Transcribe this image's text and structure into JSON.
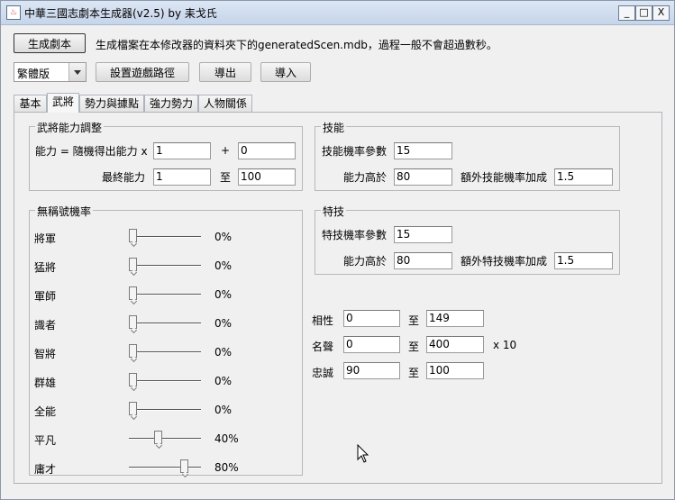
{
  "window": {
    "title": "中華三國志劇本生成器(v2.5) by 耒戈氏",
    "icon_label": "♨",
    "controls": [
      "_",
      "□",
      "X"
    ]
  },
  "top": {
    "generate_button": "生成劇本",
    "generate_hint": "生成檔案在本修改器的資料夾下的generatedScen.mdb，過程一般不會超過數秒。",
    "language_select": "繁體版",
    "set_path_button": "設置遊戲路徑",
    "export_button": "導出",
    "import_button": "導入"
  },
  "tabs": [
    "基本",
    "武將",
    "勢力與據點",
    "強力勢力",
    "人物關係"
  ],
  "active_tab": "武將",
  "ability": {
    "group_title": "武將能力調整",
    "formula_label": "能力 = 隨機得出能力 x",
    "multiplier": "1",
    "plus_label": "+",
    "offset": "0",
    "final_label": "最終能力",
    "final_min": "1",
    "to_label": "至",
    "final_max": "100"
  },
  "rank": {
    "group_title": "無稱號機率",
    "rows": [
      {
        "label": "將軍",
        "value": "0%",
        "level": 0
      },
      {
        "label": "猛將",
        "value": "0%",
        "level": 0
      },
      {
        "label": "軍師",
        "value": "0%",
        "level": 0
      },
      {
        "label": "識者",
        "value": "0%",
        "level": 0
      },
      {
        "label": "智將",
        "value": "0%",
        "level": 0
      },
      {
        "label": "群雄",
        "value": "0%",
        "level": 0
      },
      {
        "label": "全能",
        "value": "0%",
        "level": 0
      },
      {
        "label": "平凡",
        "value": "40%",
        "level": 0.4
      },
      {
        "label": "庸才",
        "value": "80%",
        "level": 0.8
      }
    ]
  },
  "skill": {
    "group_title": "技能",
    "param_label": "技能機率參數",
    "param_value": "15",
    "above_label": "能力高於",
    "above_value": "80",
    "extra_label": "額外技能機率加成",
    "extra_value": "1.5"
  },
  "special": {
    "group_title": "特技",
    "param_label": "特技機率參數",
    "param_value": "15",
    "above_label": "能力高於",
    "above_value": "80",
    "extra_label": "額外特技機率加成",
    "extra_value": "1.5"
  },
  "misc": {
    "to_label": "至",
    "affinity_label": "相性",
    "affinity_min": "0",
    "affinity_max": "149",
    "fame_label": "名聲",
    "fame_min": "0",
    "fame_max": "400",
    "fame_unit": "x 10",
    "loyalty_label": "忠誠",
    "loyalty_min": "90",
    "loyalty_max": "100"
  }
}
